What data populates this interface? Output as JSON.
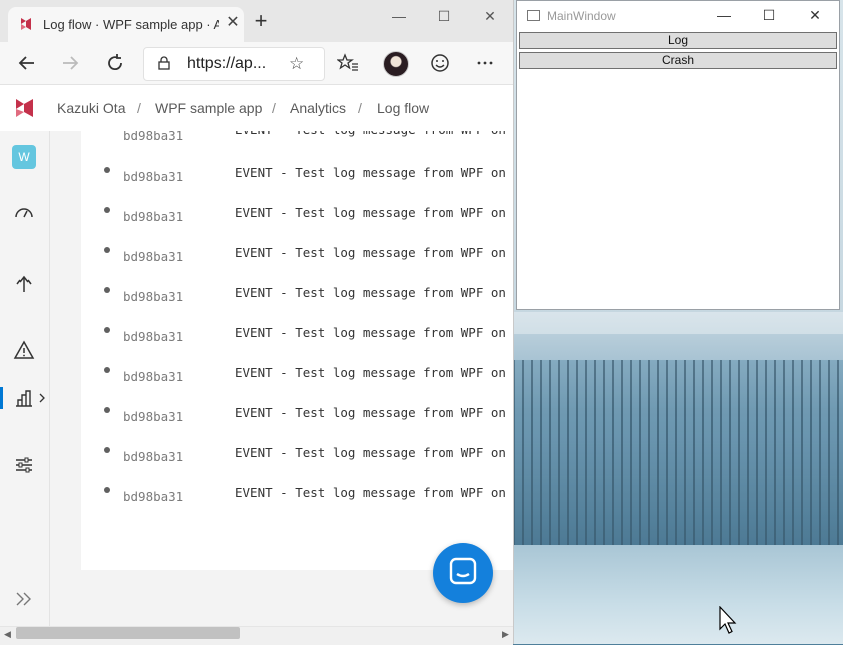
{
  "browser": {
    "tab_title": "Log flow · WPF sample app · App",
    "tab_close": "✕",
    "new_tab": "+",
    "window_buttons": {
      "minimize": "—",
      "maximize": "☐",
      "close": "✕"
    },
    "address": "https://ap...",
    "toolbar_icons": [
      "back-icon",
      "forward-icon",
      "refresh-icon",
      "lock-icon",
      "favorite-star-icon",
      "favorites-icon",
      "avatar",
      "emoji-icon",
      "more-icon"
    ]
  },
  "breadcrumb": [
    "Kazuki Ota",
    "WPF sample app",
    "Analytics",
    "Log flow"
  ],
  "breadcrumb_separator": "/",
  "sidebar": {
    "badge": "W",
    "icons": [
      "dashboard-icon",
      "deploy-icon",
      "warning-icon",
      "analytics-icon",
      "settings-sliders-icon",
      "expand-icon"
    ]
  },
  "logs": [
    {
      "id": "bd98ba31",
      "message": "EVENT - Test log message from WPF on"
    },
    {
      "id": "bd98ba31",
      "message": "EVENT - Test log message from WPF on"
    },
    {
      "id": "bd98ba31",
      "message": "EVENT - Test log message from WPF on"
    },
    {
      "id": "bd98ba31",
      "message": "EVENT - Test log message from WPF on"
    },
    {
      "id": "bd98ba31",
      "message": "EVENT - Test log message from WPF on"
    },
    {
      "id": "bd98ba31",
      "message": "EVENT - Test log message from WPF on"
    },
    {
      "id": "bd98ba31",
      "message": "EVENT - Test log message from WPF on"
    },
    {
      "id": "bd98ba31",
      "message": "EVENT - Test log message from WPF on"
    },
    {
      "id": "bd98ba31",
      "message": "EVENT - Test log message from WPF on"
    },
    {
      "id": "bd98ba31",
      "message": "EVENT - Test log message from WPF on"
    }
  ],
  "wpf": {
    "title": "MainWindow",
    "buttons": {
      "log": "Log",
      "crash": "Crash"
    },
    "controls": {
      "minimize": "—",
      "maximize": "☐",
      "close": "✕"
    }
  },
  "colors": {
    "accent": "#0078d4",
    "fab": "#1480dc",
    "brand": "#c4314b"
  }
}
